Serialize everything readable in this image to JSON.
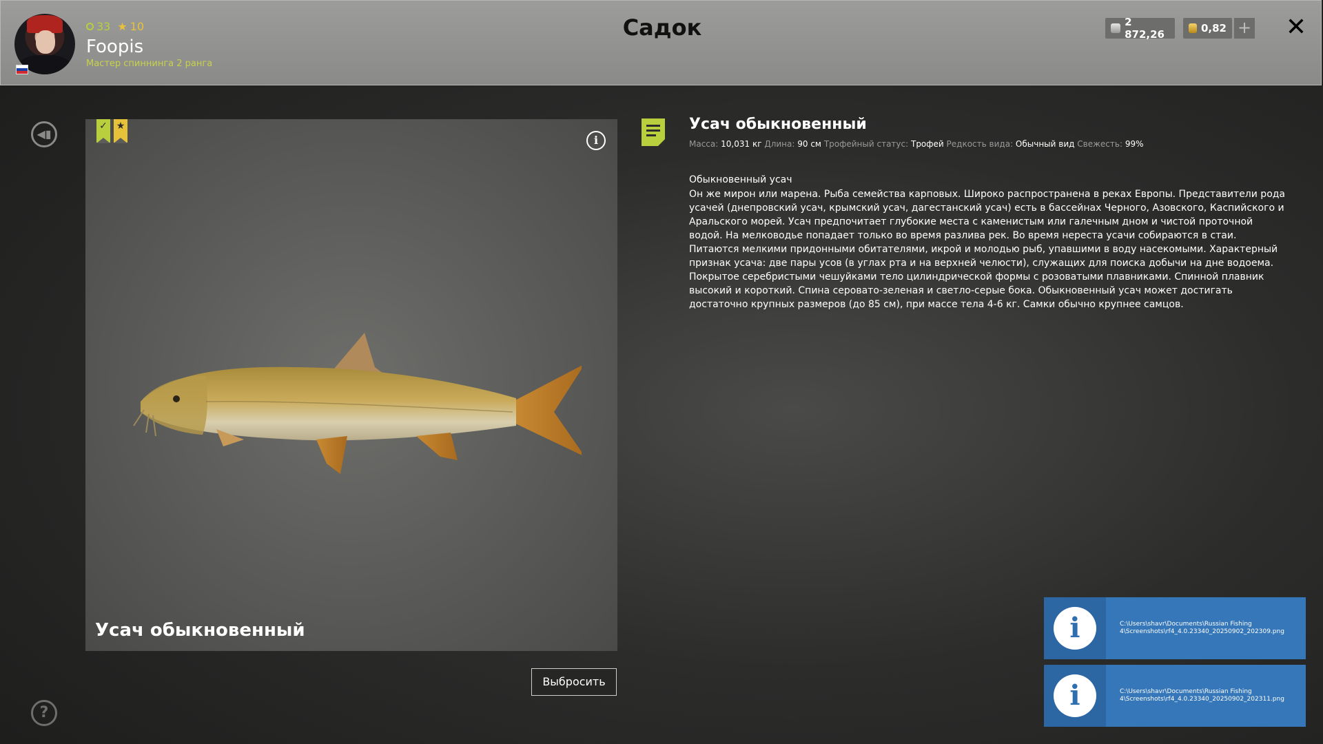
{
  "header": {
    "title": "Садок",
    "player": {
      "level": "33",
      "stars": "10",
      "name": "Foopis",
      "rank": "Мастер спиннинга 2 ранга"
    },
    "currency": {
      "silver": "2 872,26",
      "gold": "0,82"
    },
    "plus_label": "+",
    "close_label": "✕"
  },
  "fish_panel": {
    "name": "Усач обыкновенный",
    "release_label": "Выбросить",
    "badges": [
      "check",
      "star"
    ]
  },
  "details": {
    "title": "Усач обыкновенный",
    "meta": {
      "mass_label": "Масса:",
      "mass_value": "10,031 кг",
      "length_label": "Длина:",
      "length_value": "90 см",
      "trophy_label": "Трофейный статус:",
      "trophy_value": "Трофей",
      "rarity_label": "Редкость вида:",
      "rarity_value": "Обычный вид",
      "fresh_label": "Свежесть:",
      "fresh_value": "99%"
    },
    "heading": "Обыкновенный усач",
    "body": "Он же мирон или марена. Рыба семейства карповых. Широко распространена в реках Европы. Представители рода усачей (днепровский усач, крымский усач, дагестанский усач) есть в бассейнах Черного, Азовского, Каспийского и Аральского морей. Усач предпочитает глубокие места с каменистым или галечным дном и чистой проточной водой. На мелководье попадает только во время разлива рек. Во время нереста усачи собираются в стаи. Питаются мелкими придонными обитателями, икрой и молодью рыб, упавшими в воду насекомыми. Характерный признак усача: две пары усов (в углах рта и на верхней челюсти), служащих для поиска добычи на дне водоема. Покрытое серебристыми чешуйками тело цилиндрической формы с розоватыми плавниками. Спинной плавник высокий и короткий. Спина серовато-зеленая и светло-серые бока. Обыкновенный усач может достигать достаточно крупных размеров (до 85 см), при массе тела 4-6 кг. Самки обычно крупнее самцов."
  },
  "notifications": [
    {
      "path": "C:\\Users\\shavr\\Documents\\Russian Fishing 4\\Screenshots\\rf4_4.0.23340_20250902_202309.png"
    },
    {
      "path": "C:\\Users\\shavr\\Documents\\Russian Fishing 4\\Screenshots\\rf4_4.0.23340_20250902_202311.png"
    }
  ],
  "icons": {
    "back": "back-icon",
    "help": "help-icon",
    "info": "info-icon",
    "doc": "document-icon"
  },
  "colors": {
    "accent_green": "#b9cf3e",
    "accent_gold": "#e6c23a",
    "notification_blue": "#3577b8"
  }
}
